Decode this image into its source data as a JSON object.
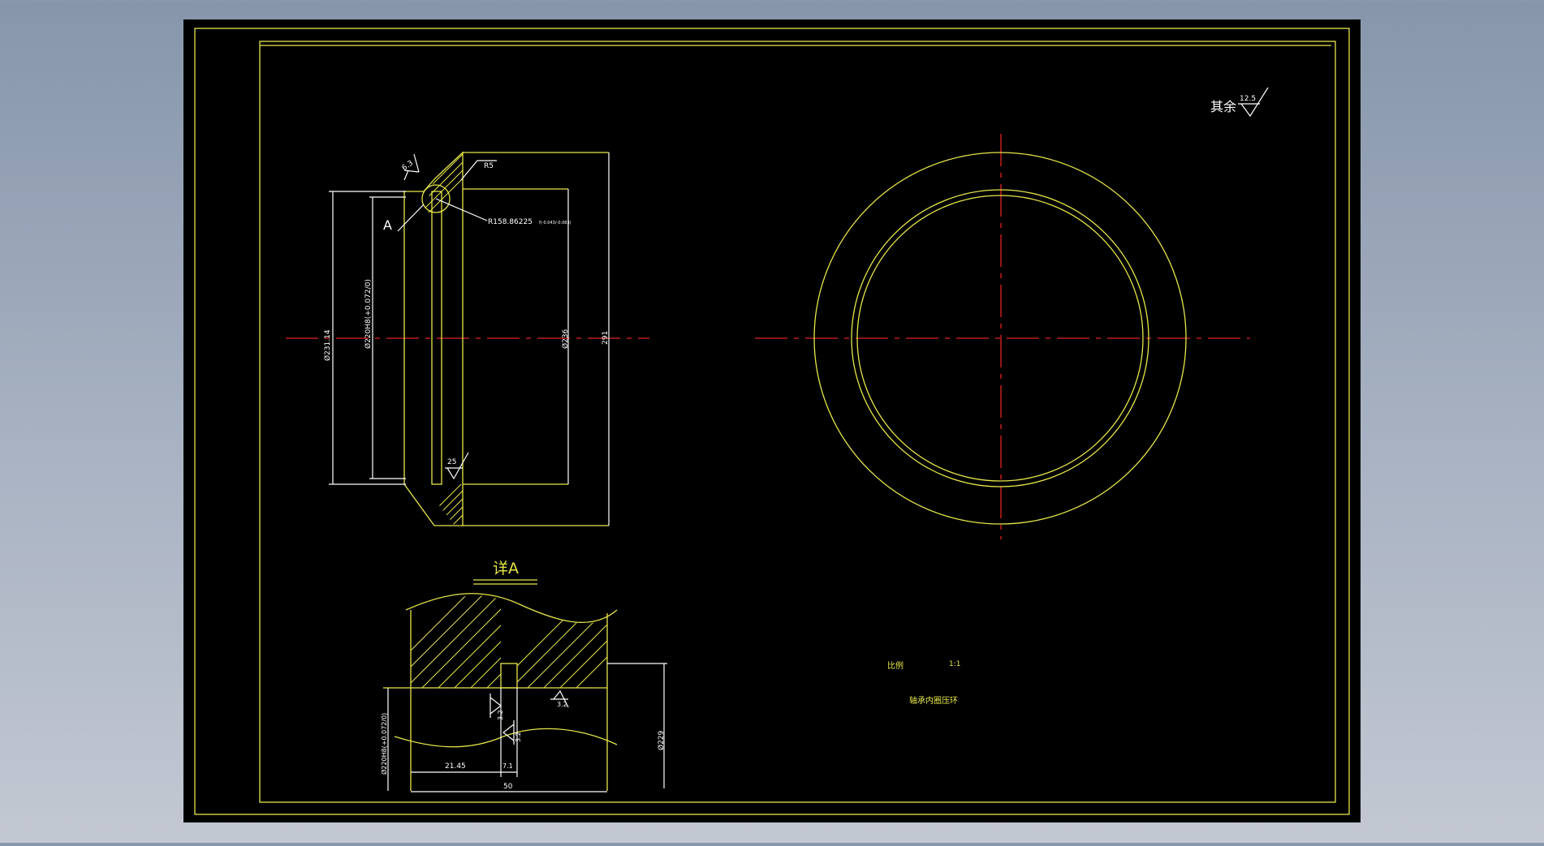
{
  "drawing": {
    "surface_note": {
      "label": "其余",
      "value": "12.5"
    },
    "title_block": {
      "scale_label": "比例",
      "scale_value": "1:1",
      "part_name": "轴承内圈压环"
    },
    "section_view": {
      "callout_a": "A",
      "dim_r5": "R5",
      "dim_roughness_63": "6.3",
      "dim_r158": "R158.86225",
      "dim_r158_tol": "f(-0.043/-0.083)",
      "dim_d231": "Ø231.14",
      "dim_d220": "Ø220H8(+0.072/0)",
      "dim_d236": "Ø236",
      "dim_291": "291",
      "dim_roughness_25": "25"
    },
    "detail_view": {
      "title": "详A",
      "dim_d220": "Ø220H8(+0.072/0)",
      "dim_d229": "Ø229",
      "dim_2145": "21.45",
      "dim_71": "7.1",
      "dim_50": "50",
      "roughness_a": "3.2",
      "roughness_b": "3.2",
      "roughness_c": "3.2"
    }
  },
  "colors": {
    "background": "#000000",
    "geometry": "#e6e64a",
    "centerline": "#e32222",
    "annotation": "#ffffff"
  }
}
